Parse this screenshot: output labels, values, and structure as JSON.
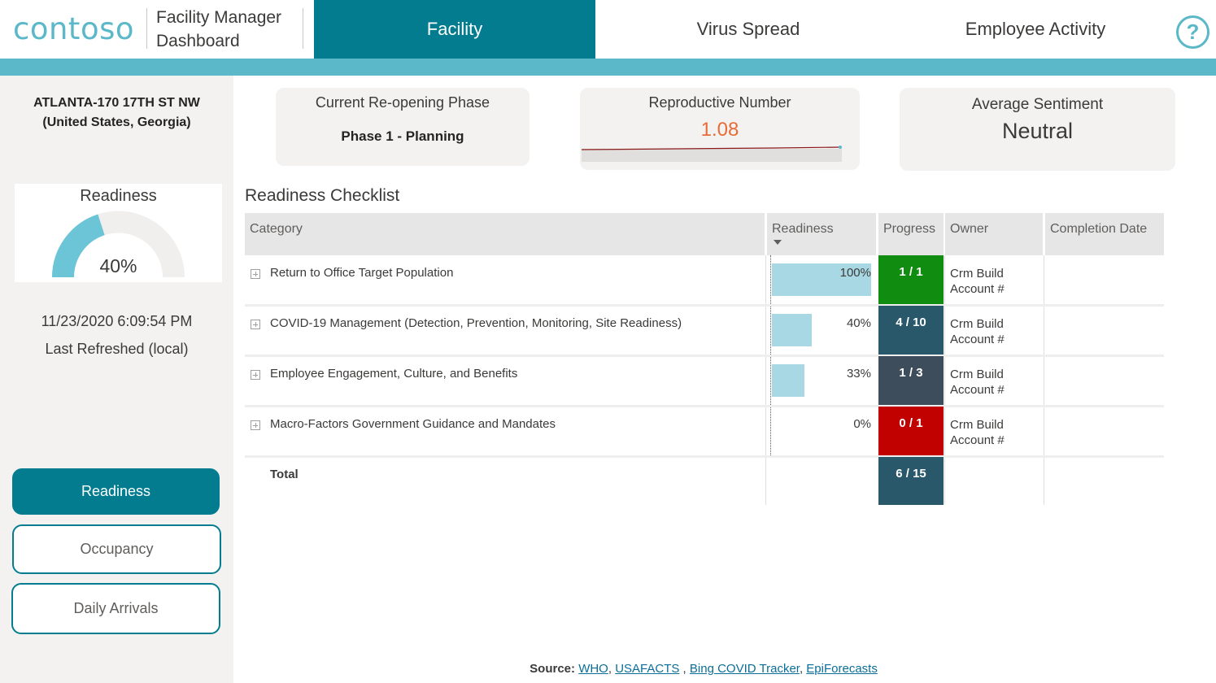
{
  "header": {
    "logo": "contoso",
    "title_line1": "Facility Manager",
    "title_line2": "Dashboard",
    "tabs": [
      {
        "label": "Facility",
        "active": true
      },
      {
        "label": "Virus Spread",
        "active": false
      },
      {
        "label": "Employee Activity",
        "active": false
      }
    ],
    "help": "?"
  },
  "colors": {
    "accent": "#037c8f",
    "light_teal": "#5ab8c9",
    "bar": "#a8d8e3",
    "green": "#108c10",
    "dark_teal": "#29586b",
    "slate": "#3e4d5c",
    "red": "#c10000",
    "orange_value": "#e66c37"
  },
  "sidebar": {
    "location_line1": "ATLANTA-170 17TH ST NW",
    "location_line2": "(United States, Georgia)",
    "gauge": {
      "title": "Readiness",
      "value_label": "40%",
      "fraction": 0.4
    },
    "refresh_time": "11/23/2020 6:09:54 PM",
    "refresh_label": "Last Refreshed (local)",
    "buttons": [
      {
        "label": "Readiness",
        "active": true
      },
      {
        "label": "Occupancy",
        "active": false
      },
      {
        "label": "Daily Arrivals",
        "active": false
      }
    ]
  },
  "kpis": {
    "phase": {
      "title": "Current Re-opening Phase",
      "value": "Phase 1 - Planning"
    },
    "repro": {
      "title": "Reproductive Number",
      "value": "1.08"
    },
    "sentiment": {
      "title": "Average Sentiment",
      "value": "Neutral"
    }
  },
  "checklist": {
    "title": "Readiness Checklist",
    "columns": [
      "Category",
      "Readiness",
      "Progress",
      "Owner",
      "Completion Date"
    ],
    "rows": [
      {
        "category": "Return to Office Target Population",
        "readiness": 1.0,
        "readiness_label": "100%",
        "progress": "1 / 1",
        "status": "green",
        "owner1": "Crm Build",
        "owner2": "Account #",
        "completion": ""
      },
      {
        "category": "COVID-19 Management (Detection, Prevention, Monitoring, Site Readiness)",
        "readiness": 0.4,
        "readiness_label": "40%",
        "progress": "4 / 10",
        "status": "dark_teal",
        "owner1": "Crm Build",
        "owner2": "Account #",
        "completion": ""
      },
      {
        "category": "Employee Engagement, Culture, and Benefits",
        "readiness": 0.33,
        "readiness_label": "33%",
        "progress": "1 / 3",
        "status": "slate",
        "owner1": "Crm Build",
        "owner2": "Account #",
        "completion": ""
      },
      {
        "category": "Macro-Factors Government Guidance and Mandates",
        "readiness": 0.0,
        "readiness_label": "0%",
        "progress": "0 / 1",
        "status": "red",
        "owner1": "Crm Build",
        "owner2": "Account #",
        "completion": ""
      }
    ],
    "total_label": "Total",
    "total_progress": "6 / 15"
  },
  "chart_data": {
    "type": "table",
    "title": "Readiness Checklist",
    "categories": [
      "Return to Office Target Population",
      "COVID-19 Management (Detection, Prevention, Monitoring, Site Readiness)",
      "Employee Engagement, Culture, and Benefits",
      "Macro-Factors Government Guidance and Mandates"
    ],
    "series": [
      {
        "name": "Readiness",
        "values": [
          100,
          40,
          33,
          0
        ]
      },
      {
        "name": "Progress",
        "values": [
          "1 / 1",
          "4 / 10",
          "1 / 3",
          "0 / 1"
        ]
      }
    ],
    "total_progress": "6 / 15"
  },
  "footer": {
    "prefix": "Source:",
    "links": [
      "WHO",
      "USAFACTS",
      "Bing COVID Tracker",
      "EpiForecasts"
    ]
  }
}
